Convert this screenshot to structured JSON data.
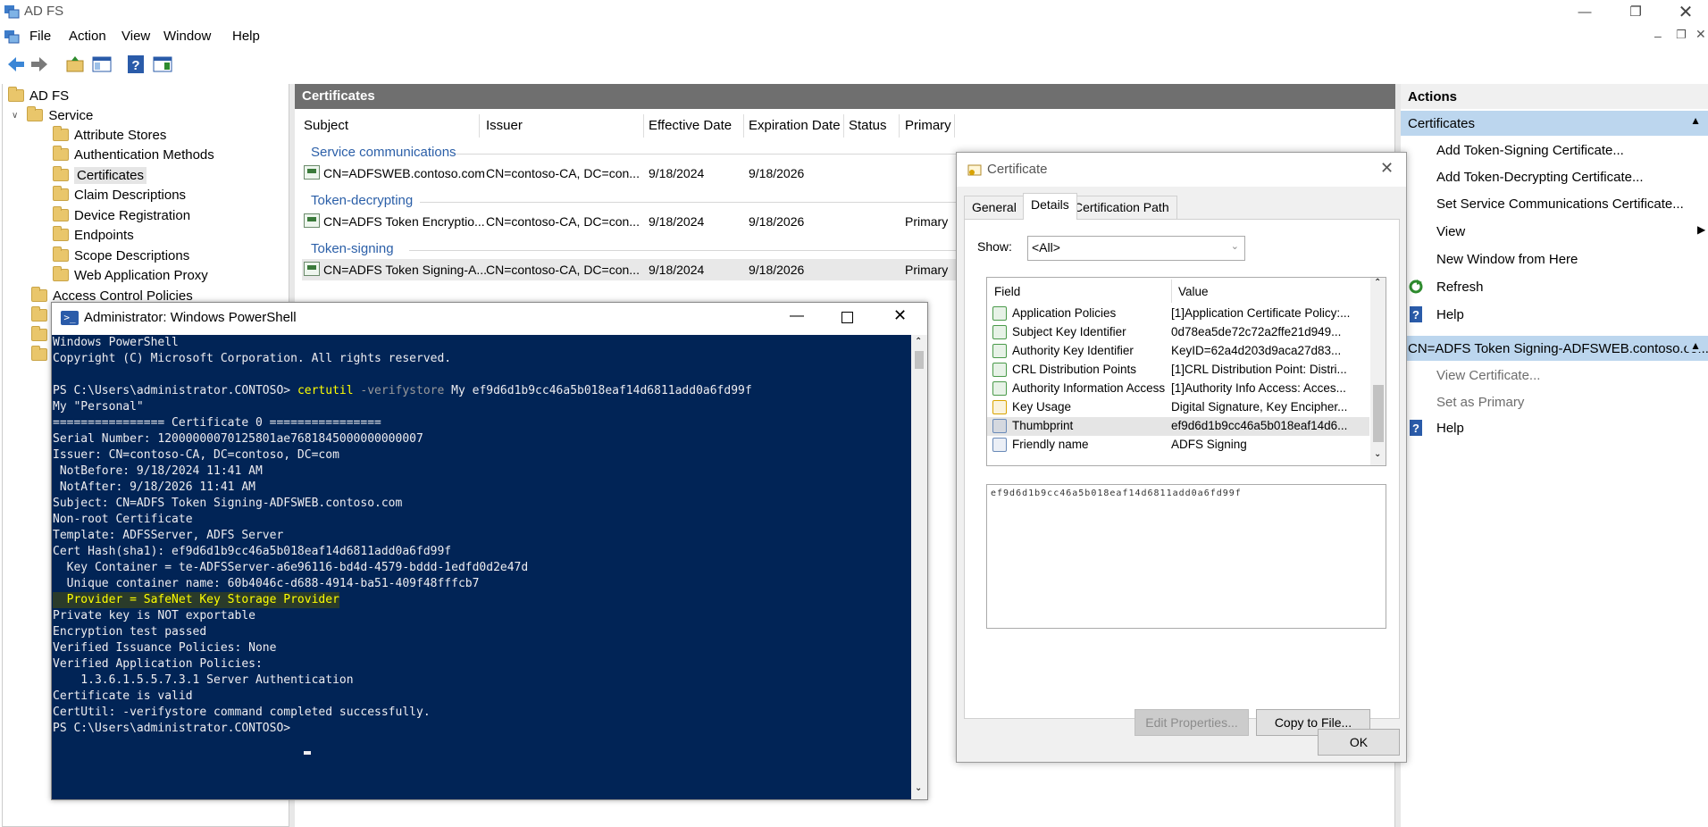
{
  "window": {
    "title": "AD FS"
  },
  "menu": [
    "File",
    "Action",
    "View",
    "Window",
    "Help"
  ],
  "tree": {
    "root": "AD FS",
    "service": "Service",
    "children": [
      "Attribute Stores",
      "Authentication Methods",
      "Certificates",
      "Claim Descriptions",
      "Device Registration",
      "Endpoints",
      "Scope Descriptions",
      "Web Application Proxy"
    ],
    "access_control": "Access Control Policies"
  },
  "center": {
    "title": "Certificates",
    "columns": [
      "Subject",
      "Issuer",
      "Effective Date",
      "Expiration Date",
      "Status",
      "Primary"
    ],
    "groups": [
      {
        "name": "Service communications",
        "row": {
          "subject": "CN=ADFSWEB.contoso.com",
          "issuer": "CN=contoso-CA, DC=con...",
          "effective": "9/18/2024",
          "expiration": "9/18/2026",
          "status": "",
          "primary": ""
        }
      },
      {
        "name": "Token-decrypting",
        "row": {
          "subject": "CN=ADFS Token Encryptio...",
          "issuer": "CN=contoso-CA, DC=con...",
          "effective": "9/18/2024",
          "expiration": "9/18/2026",
          "status": "",
          "primary": "Primary"
        }
      },
      {
        "name": "Token-signing",
        "row": {
          "subject": "CN=ADFS Token Signing-A...",
          "issuer": "CN=contoso-CA, DC=con...",
          "effective": "9/18/2024",
          "expiration": "9/18/2026",
          "status": "",
          "primary": "Primary"
        }
      }
    ]
  },
  "actions": {
    "title": "Actions",
    "section1": "Certificates",
    "items1": [
      "Add Token-Signing Certificate...",
      "Add Token-Decrypting Certificate...",
      "Set Service Communications Certificate...",
      "View",
      "New Window from Here",
      "Refresh",
      "Help"
    ],
    "section2": "CN=ADFS Token Signing-ADFSWEB.contoso.co...",
    "items2": [
      "View Certificate...",
      "Set as Primary",
      "Help"
    ]
  },
  "powershell": {
    "title": "Administrator: Windows PowerShell",
    "lines": [
      "Windows PowerShell",
      "Copyright (C) Microsoft Corporation. All rights reserved.",
      "",
      "",
      "My \"Personal\"",
      "================ Certificate 0 ================",
      "Serial Number: 12000000070125801ae7681845000000000007",
      "Issuer: CN=contoso-CA, DC=contoso, DC=com",
      " NotBefore: 9/18/2024 11:41 AM",
      " NotAfter: 9/18/2026 11:41 AM",
      "Subject: CN=ADFS Token Signing-ADFSWEB.contoso.com",
      "Non-root Certificate",
      "Template: ADFSServer, ADFS Server",
      "Cert Hash(sha1): ef9d6d1b9cc46a5b018eaf14d6811add0a6fd99f",
      "  Key Container = te-ADFSServer-a6e96116-bd4d-4579-bddd-1edfd0d2e47d",
      "  Unique container name: 60b4046c-d688-4914-ba51-409f48fffcb7",
      "",
      "Private key is NOT exportable",
      "Encryption test passed",
      "Verified Issuance Policies: None",
      "Verified Application Policies:",
      "    1.3.6.1.5.5.7.3.1 Server Authentication",
      "Certificate is valid",
      "CertUtil: -verifystore command completed successfully.",
      "PS C:\\Users\\administrator.CONTOSO> "
    ],
    "prompt": "PS C:\\Users\\administrator.CONTOSO> ",
    "cmd": "certutil",
    "param": "-verifystore",
    "args": " My ef9d6d1b9cc46a5b018eaf14d6811add0a6fd99f",
    "highlight": "  Provider = SafeNet Key Storage Provider"
  },
  "cert_dialog": {
    "title": "Certificate",
    "tabs": [
      "General",
      "Details",
      "Certification Path"
    ],
    "show_label": "Show:",
    "show_value": "<All>",
    "field_header": "Field",
    "value_header": "Value",
    "fields": [
      {
        "name": "Application Policies",
        "value": "[1]Application Certificate Policy:..."
      },
      {
        "name": "Subject Key Identifier",
        "value": "0d78ea5de72c72a2ffe21d949..."
      },
      {
        "name": "Authority Key Identifier",
        "value": "KeyID=62a4d203d9aca27d83..."
      },
      {
        "name": "CRL Distribution Points",
        "value": "[1]CRL Distribution Point: Distri..."
      },
      {
        "name": "Authority Information Access",
        "value": "[1]Authority Info Access: Acces..."
      },
      {
        "name": "Key Usage",
        "value": "Digital Signature, Key Encipher..."
      },
      {
        "name": "Thumbprint",
        "value": "ef9d6d1b9cc46a5b018eaf14d6..."
      },
      {
        "name": "Friendly name",
        "value": "ADFS Signing"
      }
    ],
    "value_text": "ef9d6d1b9cc46a5b018eaf14d6811add0a6fd99f",
    "edit_properties": "Edit Properties...",
    "copy_to_file": "Copy to File...",
    "ok": "OK"
  }
}
